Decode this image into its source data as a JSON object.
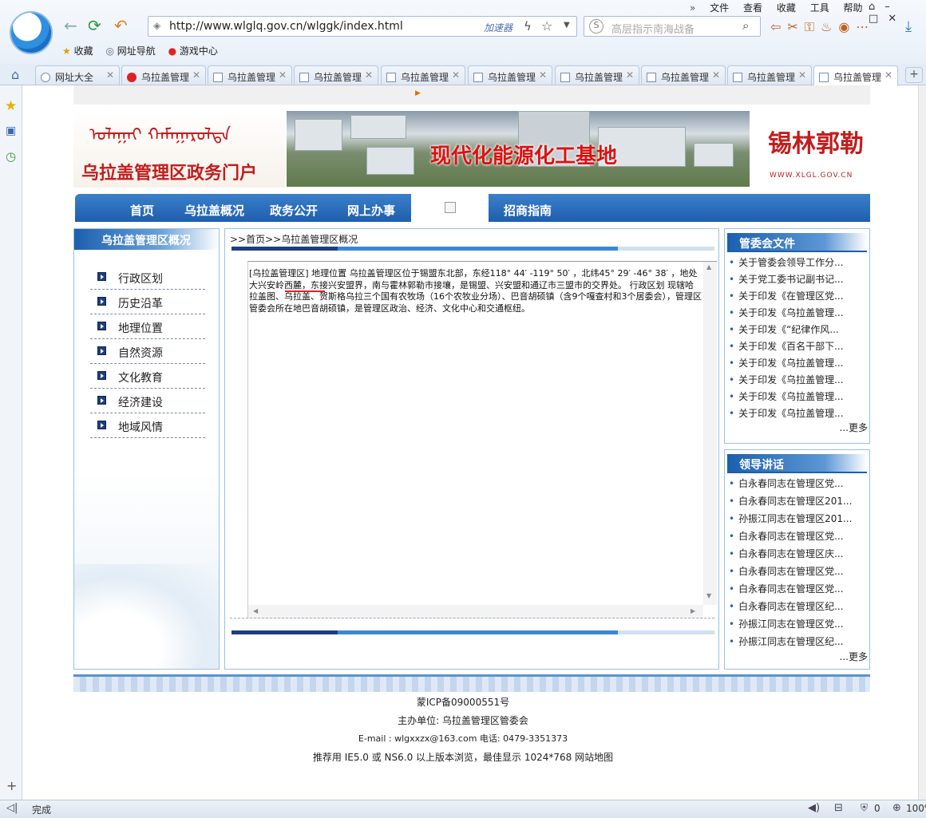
{
  "browser": {
    "url": "http://www.wlglq.gov.cn/wlggk/index.html",
    "accelerator": "加速器",
    "search_placeholder": "高层指示南海战备",
    "menu": [
      "文件",
      "查看",
      "收藏",
      "工具",
      "帮助"
    ],
    "favorites": [
      "收藏",
      "网址导航",
      "游戏中心"
    ],
    "tabs": [
      "网址大全",
      "乌拉盖管理",
      "乌拉盖管理",
      "乌拉盖管理",
      "乌拉盖管理",
      "乌拉盖管理",
      "乌拉盖管理",
      "乌拉盖管理",
      "乌拉盖管理",
      "乌拉盖管理"
    ],
    "status": "完成",
    "status_count": "0",
    "zoom": "100%"
  },
  "banner": {
    "mongolian": "ᠤᠯᠠᠭᠠᠢ ᠬᠠᠮᠠᠭᠠᠷᠤᠯᠲᠠ",
    "portal_title": "乌拉盖管理区政务门户",
    "slogan": "现代化能源化工基地",
    "calligraphy": "锡林郭勒",
    "site": "WWW.XLGL.GOV.CN"
  },
  "nav": [
    "首页",
    "乌拉盖概况",
    "政务公开",
    "网上办事",
    "招商指南"
  ],
  "left": {
    "title": "乌拉盖管理区概况",
    "items": [
      "行政区划",
      "历史沿革",
      "地理位置",
      "自然资源",
      "文化教育",
      "经济建设",
      "地域风情"
    ]
  },
  "main": {
    "breadcrumb": ">>首页>>乌拉盖管理区概况",
    "text": "[乌拉盖管理区] 地理位置 乌拉盖管理区位于锡盟东北部，东经118° 44′ -119° 50′ ，北纬45° 29′ -46° 38′ ，地处大兴安岭西麓，东接兴安盟界，南与霍林郭勒市接壤，是锡盟、兴安盟和通辽市三盟市的交界处。 行政区划 现辖哈拉盖图、乌拉盖、贺斯格乌拉三个国有农牧场（16个农牧业分场）、巴音胡硕镇（含9个嘎查村和3个居委会），管理区管委会所在地巴音胡硕镇，是管理区政治、经济、文化中心和交通枢纽。"
  },
  "right1": {
    "title": "管委会文件",
    "items": [
      "关于管委会领导工作分...",
      "关于党工委书记副书记...",
      "关于印发《在管理区党...",
      "关于印发《乌拉盖管理...",
      "关于印发《“纪律作风...",
      "关于印发《百名干部下...",
      "关于印发《乌拉盖管理...",
      "关于印发《乌拉盖管理...",
      "关于印发《乌拉盖管理...",
      "关于印发《乌拉盖管理..."
    ],
    "more": "...更多"
  },
  "right2": {
    "title": "领导讲话",
    "items": [
      "白永春同志在管理区党...",
      "白永春同志在管理区201...",
      "孙振江同志在管理区201...",
      "白永春同志在管理区党...",
      "白永春同志在管理区庆...",
      "白永春同志在管理区党...",
      "白永春同志在管理区党...",
      "白永春同志在管理区纪...",
      "孙振江同志在管理区党...",
      "孙振江同志在管理区纪..."
    ],
    "more": "...更多"
  },
  "footer": {
    "icp": "蒙ICP备09000551号",
    "host": "主办单位: 乌拉盖管理区管委会",
    "contact": "E-mail : wlgxxzx@163.com 电话: 0479-3351373",
    "recommend": "推荐用 IE5.0 或 NS6.0 以上版本浏览，最佳显示 1024*768 网站地图"
  }
}
